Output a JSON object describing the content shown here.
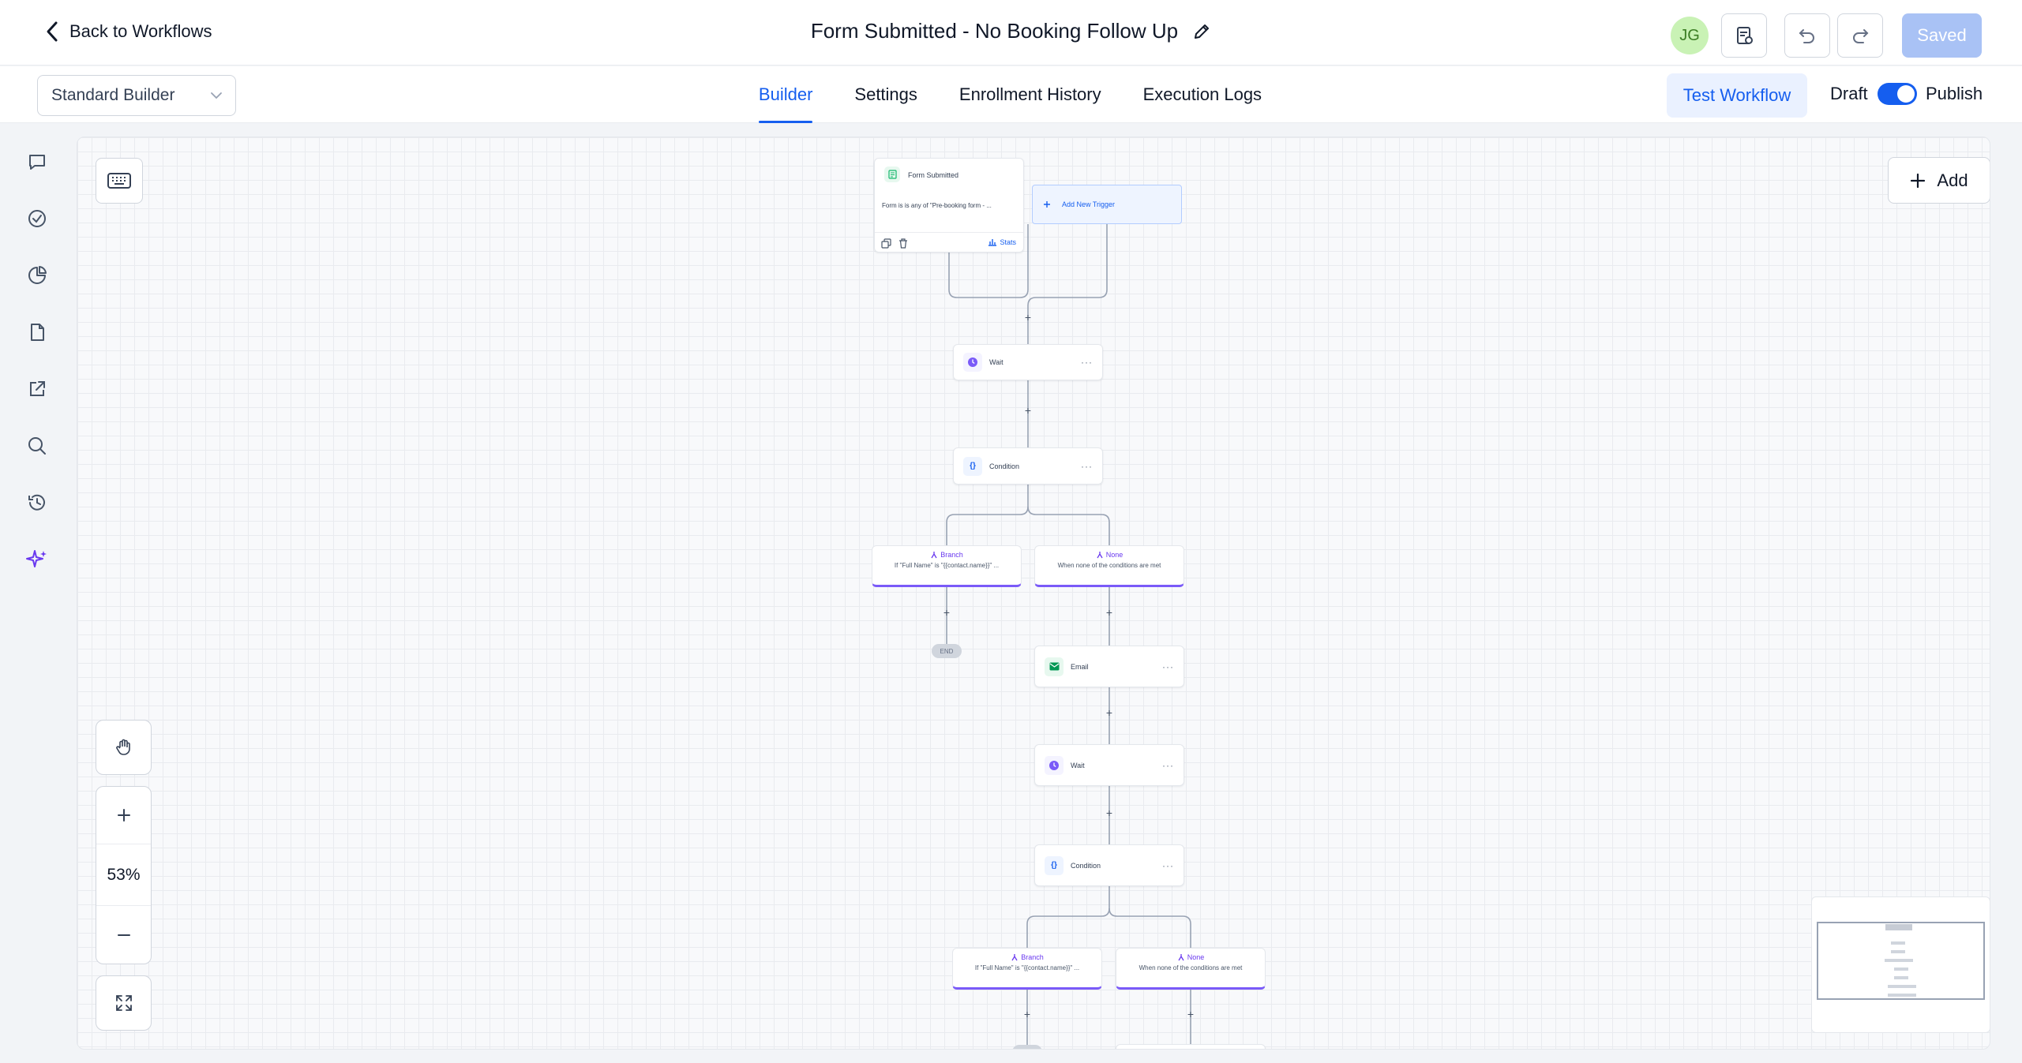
{
  "header": {
    "back_label": "Back to Workflows",
    "title": "Form Submitted - No Booking Follow Up",
    "avatar_initials": "JG",
    "saved_label": "Saved"
  },
  "subheader": {
    "builder_select": "Standard Builder",
    "tabs": [
      {
        "label": "Builder",
        "active": true
      },
      {
        "label": "Settings",
        "active": false
      },
      {
        "label": "Enrollment History",
        "active": false
      },
      {
        "label": "Execution Logs",
        "active": false
      }
    ],
    "test_label": "Test Workflow",
    "draft_label": "Draft",
    "publish_label": "Publish",
    "publish_toggle_on": true
  },
  "rail": {
    "icons": [
      "chat-icon",
      "check-circle-icon",
      "pie-chart-icon",
      "file-icon",
      "external-link-icon",
      "search-icon",
      "history-icon",
      "sparkle-icon"
    ]
  },
  "canvas": {
    "add_label": "Add",
    "zoom_label": "53%",
    "trigger": {
      "title": "Form Submitted",
      "description": "Form is is any of \"Pre-booking form - ...",
      "stats_label": "Stats"
    },
    "add_trigger_label": "Add New Trigger",
    "wait1_label": "Wait",
    "condition1_label": "Condition",
    "branch1": {
      "title": "Branch",
      "desc": "If \"Full Name\" is \"{{contact.name}}\" ..."
    },
    "none1": {
      "title": "None",
      "desc": "When none of the conditions are met"
    },
    "end_label": "END",
    "email_label": "Email",
    "wait2_label": "Wait",
    "condition2_label": "Condition",
    "branch2": {
      "title": "Branch",
      "desc": "If \"Full Name\" is \"{{contact.name}}\" ..."
    },
    "none2": {
      "title": "None",
      "desc": "When none of the conditions are met"
    }
  },
  "colors": {
    "accent": "#155eef",
    "branch_accent": "#7a5af8",
    "saved_bg": "#a9c2f5",
    "avatar_bg": "#c9f2b5"
  }
}
